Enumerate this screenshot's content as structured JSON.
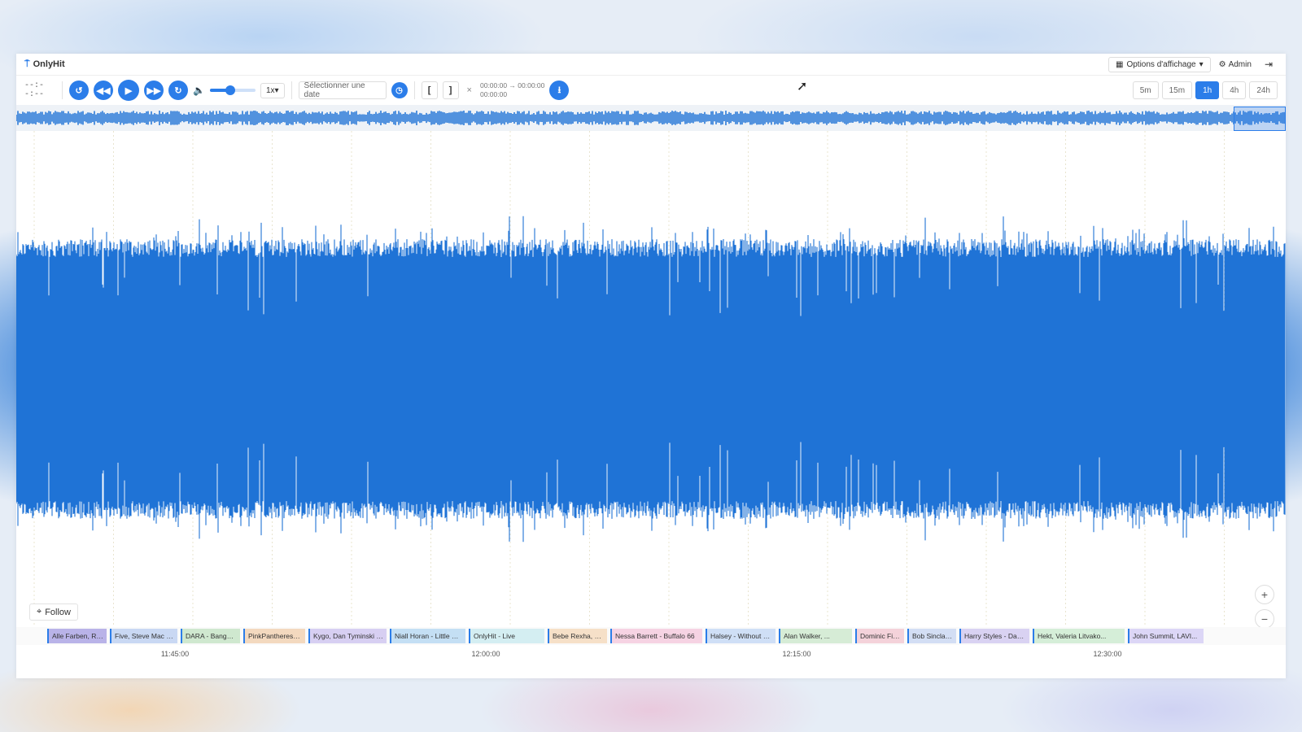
{
  "app": {
    "title": "OnlyHit",
    "options_label": "Options d'affichage",
    "admin_label": "Admin"
  },
  "toolbar": {
    "time": "--:--:--",
    "speed": "1x",
    "date_placeholder": "Sélectionner une date",
    "open_bracket": "[",
    "close_bracket": "]",
    "clear": "×",
    "range_line1": "00:00:00 → 00:00:00",
    "range_line2": "00:00:00",
    "volume_level": 0.45
  },
  "zoom_buttons": [
    "5m",
    "15m",
    "1h",
    "4h",
    "24h"
  ],
  "active_zoom": "1h",
  "follow_label": "Follow",
  "tracks": [
    {
      "label": "Alle Farben, Re...",
      "color": "#b9b3e8"
    },
    {
      "label": "Five, Steve Mac - K...",
      "color": "#c9d8f3"
    },
    {
      "label": "DARA - Bangar...",
      "color": "#cfe8cf"
    },
    {
      "label": "PinkPantheress, ...",
      "color": "#f3d9bf"
    },
    {
      "label": "Kygo, Dan Tyminski - ...",
      "color": "#d7cff2"
    },
    {
      "label": "Niall Horan - Little Mor...",
      "color": "#c4dff4"
    },
    {
      "label": "OnlyHit - Live",
      "color": "#d4eef2"
    },
    {
      "label": "Bebe Rexha, Fa...",
      "color": "#f6e0c8"
    },
    {
      "label": "Nessa Barrett - Buffalo 66",
      "color": "#f6d3e3"
    },
    {
      "label": "Halsey - Without Me",
      "color": "#cfdff6"
    },
    {
      "label": "Alan Walker, ...",
      "color": "#d6ecd6"
    },
    {
      "label": "Dominic Fik...",
      "color": "#f4d2da"
    },
    {
      "label": "Bob Sinclar, ...",
      "color": "#d3def4"
    },
    {
      "label": "Harry Styles - Danc...",
      "color": "#d9d2f2"
    },
    {
      "label": "Hekt, Valeria Litvako...",
      "color": "#d5eed8"
    },
    {
      "label": "John Summit, LAVI...",
      "color": "#dcd6f6"
    }
  ],
  "timeline": [
    "11:45:00",
    "12:00:00",
    "12:15:00",
    "12:30:00"
  ],
  "colors": {
    "accent": "#2b7de9",
    "wave": "#1f73d6"
  },
  "icons": {
    "rewind": "rotate-left-icon",
    "back": "backward-icon",
    "play": "play-icon",
    "forward": "forward-icon",
    "redo": "rotate-right-icon",
    "volume": "volume-icon",
    "clock": "clock-icon",
    "download": "download-icon",
    "settings": "gear-icon",
    "logout": "logout-icon",
    "table": "table-icon",
    "follow": "crosshair-icon"
  }
}
